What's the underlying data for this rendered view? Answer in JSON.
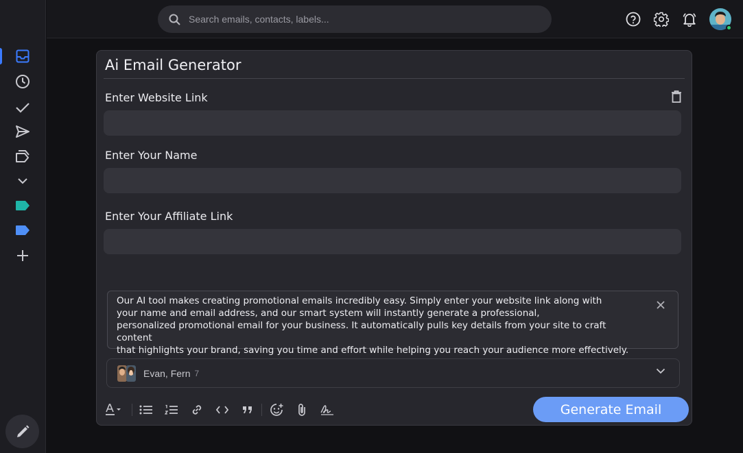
{
  "colors": {
    "accent": "#3b7bff",
    "button": "#6b9cf6",
    "label_teal": "#1fb5a8",
    "label_blue": "#4f8ff7",
    "online": "#2ecc71"
  },
  "search": {
    "placeholder": "Search emails, contacts, labels..."
  },
  "sidebar": {
    "items": [
      {
        "icon": "inbox-icon",
        "active": true
      },
      {
        "icon": "clock-icon"
      },
      {
        "icon": "checkmark-icon"
      },
      {
        "icon": "send-icon"
      },
      {
        "icon": "labels-icon"
      },
      {
        "icon": "chevron-down-icon"
      },
      {
        "icon": "label-tag-icon",
        "color": "#1fb5a8"
      },
      {
        "icon": "label-tag-icon",
        "color": "#4f8ff7"
      },
      {
        "icon": "plus-icon"
      }
    ],
    "compose_icon": "pencil-icon"
  },
  "header_icons": [
    "help-icon",
    "settings-gear-icon",
    "notification-bell-icon",
    "user-avatar"
  ],
  "panel": {
    "title": "Ai Email Generator",
    "fields": [
      {
        "label": "Enter Website Link",
        "value": ""
      },
      {
        "label": "Enter Your Name",
        "value": ""
      },
      {
        "label": "Enter Your Affiliate Link",
        "value": ""
      }
    ],
    "description": "Our AI tool makes creating promotional emails incredibly easy. Simply enter your website link along with\nyour name and email address, and our smart system will instantly generate a professional,\npersonalized promotional email for your business. It automatically pulls key details from your site to craft content\nthat highlights your brand, saving you time and effort while helping you reach your audience more effectively.",
    "recipients": {
      "names": "Evan, Fern",
      "count": "7"
    },
    "toolbar": [
      "text-color-icon",
      "bullet-list-icon",
      "numbered-list-icon",
      "link-icon",
      "code-icon",
      "quote-icon",
      "emoji-icon",
      "attachment-icon",
      "signature-icon"
    ],
    "generate_label": "Generate Email"
  }
}
